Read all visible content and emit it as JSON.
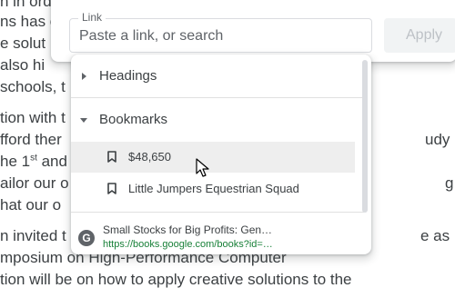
{
  "document": {
    "lines": [
      "n in ord",
      "ns has e",
      "e solut",
      "also hi",
      "schools, t",
      "tion with t",
      "fford ther",
      "he 1",
      "ailor our o",
      "hat our o",
      "n invited t",
      "mposium on High-Performance Computer",
      "tion will be on how to apply creative solutions to the"
    ],
    "right_fragments": [
      "udy",
      "g",
      "e as"
    ],
    "superscript": "st",
    "line7_tail": " and"
  },
  "link_dialog": {
    "label": "Link",
    "placeholder": "Paste a link, or search",
    "value": "",
    "apply_label": "Apply"
  },
  "dropdown": {
    "headings_label": "Headings",
    "bookmarks_label": "Bookmarks",
    "bookmarks": [
      {
        "label": "$48,650",
        "highlighted": true
      },
      {
        "label": "Little Jumpers Equestrian Squad",
        "highlighted": false
      }
    ],
    "suggestion": {
      "title": "Small Stocks for Big Profits: Gen…",
      "url": "https://books.google.com/books?id=…",
      "icon": "google-g-icon"
    }
  },
  "colors": {
    "url_green": "#188038",
    "highlight": "#eeeeee",
    "icon_gray": "#5f6368"
  }
}
